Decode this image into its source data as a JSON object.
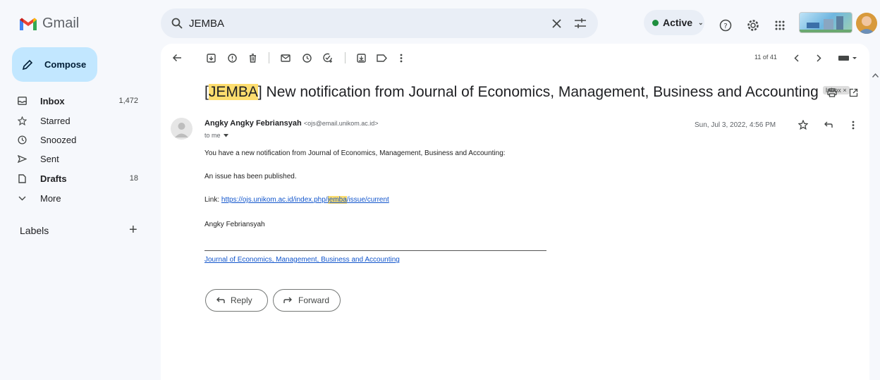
{
  "app": {
    "name": "Gmail"
  },
  "search": {
    "query": "JEMBA"
  },
  "header": {
    "status": "Active",
    "status_color": "#1e8e3e"
  },
  "sidebar": {
    "compose": "Compose",
    "items": [
      {
        "label": "Inbox",
        "count": "1,472",
        "icon": "inbox-icon"
      },
      {
        "label": "Starred",
        "count": "",
        "icon": "star-icon"
      },
      {
        "label": "Snoozed",
        "count": "",
        "icon": "clock-icon"
      },
      {
        "label": "Sent",
        "count": "",
        "icon": "send-icon"
      },
      {
        "label": "Drafts",
        "count": "18",
        "icon": "file-icon"
      },
      {
        "label": "More",
        "count": "",
        "icon": "chevron-down-icon"
      }
    ],
    "labels_heading": "Labels",
    "labels_add": "+"
  },
  "toolbar": {
    "pagination": "11 of 41"
  },
  "message": {
    "subject_prefix": "[",
    "subject_highlight": "JEMBA",
    "subject_rest": "] New notification from Journal of Economics, Management, Business and Accounting",
    "label_chip": "Inbox",
    "label_chip_close": "×",
    "sender_name": "Angky Angky Febriansyah",
    "sender_email": "<ojs@email.unikom.ac.id>",
    "to": "to me",
    "date": "Sun, Jul 3, 2022, 4:56 PM",
    "line1": "You have a new notification from Journal of Economics, Management, Business and Accounting:",
    "line2": "An issue has been published.",
    "link_label": "Link:",
    "link_part1": "https://ojs.unikom.ac.id/index.php/",
    "link_highlight": "jemba",
    "link_part2": "/issue/current",
    "signature_name": "Angky Febriansyah",
    "journal_link": "Journal of Economics, Management, Business and Accounting"
  },
  "actions": {
    "reply": "Reply",
    "forward": "Forward"
  },
  "colors": {
    "accent": "#c2e7ff",
    "highlight": "#fddd6e",
    "link": "#1155cc"
  }
}
